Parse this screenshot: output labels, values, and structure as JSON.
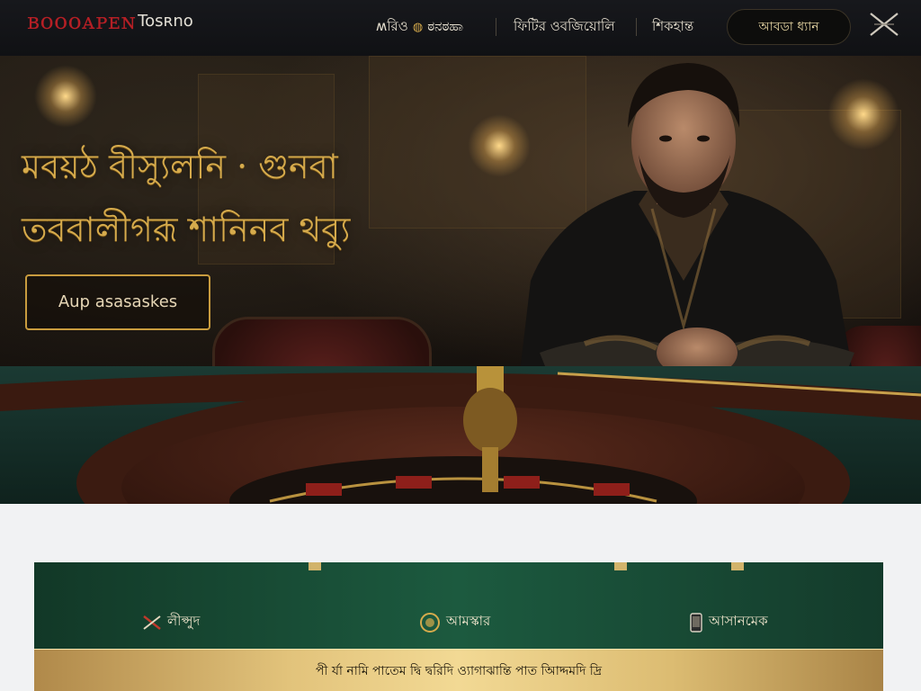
{
  "header": {
    "logo_main": "ʙᴏᴏᴏᴀᴘᴇɴ",
    "logo_sub": "Tosʀno",
    "nav": [
      {
        "label_a": "ʍরিও",
        "label_b": "ಠನಠಹಾ",
        "icon": "coin-icon"
      },
      {
        "label": "ফিটির ওবজিয়োলি",
        "icon": "none"
      },
      {
        "label": "শিকহান্ত",
        "icon": "none"
      }
    ],
    "login_label": "আবডা ধ্যান",
    "menu_icon": "close-cross-icon"
  },
  "hero": {
    "title_line1": "মবয়ঠ বীস্যুলনি · গুনবা",
    "title_line2": "তববালীগরূ শানিনব থব্যু",
    "cta_label": "Aup asasaskes"
  },
  "panel": {
    "tabs": [
      {
        "label": "লীপ্সুদ",
        "icon": "cross-swords-icon"
      },
      {
        "label": "আমস্কার",
        "icon": "coin-icon"
      },
      {
        "label": "আসানমেক",
        "icon": "phone-icon"
      }
    ],
    "banner_text": "পী র্যা নামি পাতেম দ্বি দ্বরিদি ও্যাগাঝান্তি পাত আিদ্দমদি দ্রি"
  },
  "colors": {
    "accent_gold": "#d6ab4c",
    "brand_red": "#b51f25",
    "panel_green": "#1c5a3f"
  }
}
